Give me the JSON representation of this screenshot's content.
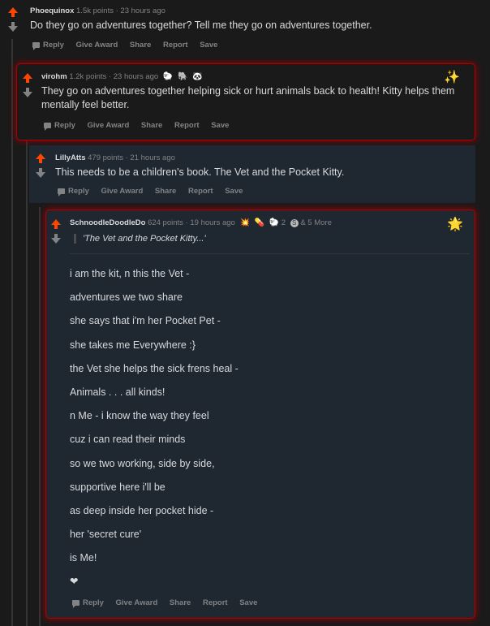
{
  "actions": {
    "reply": "Reply",
    "give_award": "Give Award",
    "share": "Share",
    "report": "Report",
    "save": "Save"
  },
  "comments": [
    {
      "user": "Phoequinox",
      "points": "1.5k points",
      "time": "23 hours ago",
      "text": "Do they go on adventures together? Tell me they go on adventures together."
    },
    {
      "user": "virohm",
      "points": "1.2k points",
      "time": "23 hours ago",
      "awards": [
        "🐑",
        "🐘",
        "🐼"
      ],
      "text": "They go on adventures together helping sick or hurt animals back to health! Kitty helps them mentally feel better."
    },
    {
      "user": "LillyAtts",
      "points": "479 points",
      "time": "21 hours ago",
      "text": "This needs to be a children's book. The Vet and the Pocket Kitty."
    },
    {
      "user": "SchnoodleDoodleDo",
      "points": "624 points",
      "time": "19 hours ago",
      "awards": [
        "💥",
        "💊",
        "🐑"
      ],
      "award_count": "2",
      "more_awards": "& 5 More",
      "quote": "'The Vet and the Pocket Kitty...'",
      "poem": [
        "i am the kit, n this the Vet -",
        "adventures we two share",
        "she says that i'm her Pocket Pet -",
        "she takes me Everywhere :}",
        "the Vet she helps the sick frens heal -",
        "Animals . . . all kinds!",
        "n Me - i know the way they feel",
        "cuz i can read their minds",
        "so we two working, side by side,",
        "supportive here i'll be",
        "as deep inside her pocket hide -",
        "her 'secret cure'",
        "is Me!"
      ],
      "heart": "❤"
    }
  ],
  "colors": {
    "upvote": "#ff4500",
    "highlight_border": "#b00000",
    "background": "#1a1a1b",
    "nested_bg": "#1f2731"
  }
}
